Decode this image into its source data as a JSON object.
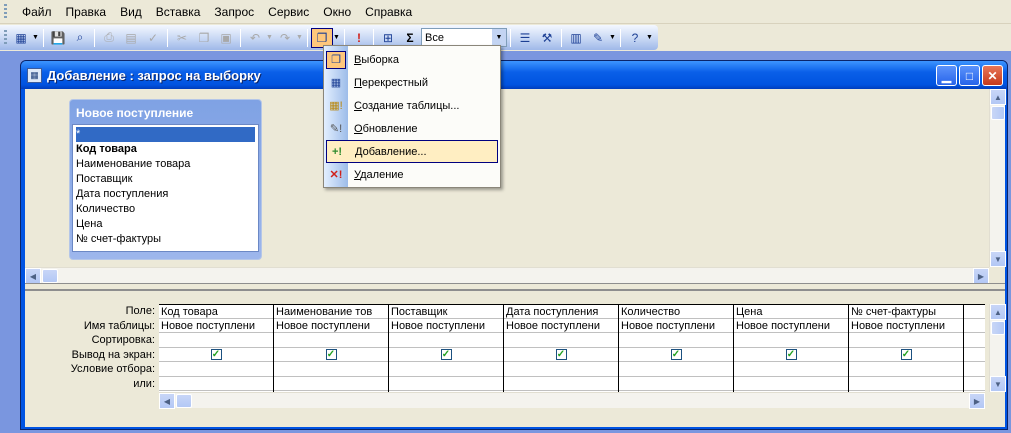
{
  "menubar": {
    "items": [
      "Файл",
      "Правка",
      "Вид",
      "Вставка",
      "Запрос",
      "Сервис",
      "Окно",
      "Справка"
    ]
  },
  "toolbar": {
    "combo_value": "Все",
    "icons": [
      "view-icon",
      "save-icon",
      "search-icon",
      "print-icon",
      "preview-icon",
      "spell-icon",
      "cut-icon",
      "copy-icon",
      "paste-icon",
      "undo-icon",
      "redo-icon",
      "query-type-icon",
      "run-icon",
      "show-table-icon",
      "totals-icon",
      "properties-icon",
      "build-icon",
      "database-window-icon",
      "new-object-icon",
      "help-icon"
    ]
  },
  "window": {
    "title": "Добавление : запрос на выборку"
  },
  "field_list": {
    "title": "Новое поступление",
    "fields": [
      "*",
      "Код товара",
      "Наименование товара",
      "Поставщик",
      "Дата поступления",
      "Количество",
      "Цена",
      "№ счет-фактуры"
    ]
  },
  "query_grid": {
    "row_labels": [
      "Поле:",
      "Имя таблицы:",
      "Сортировка:",
      "Вывод на экран:",
      "Условие отбора:",
      "или:"
    ],
    "columns": [
      {
        "field": "Код товара",
        "table": "Новое поступлени",
        "show": true
      },
      {
        "field": "Наименование тов",
        "table": "Новое поступлени",
        "show": true
      },
      {
        "field": "Поставщик",
        "table": "Новое поступлени",
        "show": true
      },
      {
        "field": "Дата поступления",
        "table": "Новое поступлени",
        "show": true
      },
      {
        "field": "Количество",
        "table": "Новое поступлени",
        "show": true
      },
      {
        "field": "Цена",
        "table": "Новое поступлени",
        "show": true
      },
      {
        "field": "№ счет-фактуры",
        "table": "Новое поступлени",
        "show": true
      },
      {
        "field": "",
        "table": "",
        "show": false
      }
    ]
  },
  "query_type_menu": {
    "items": [
      {
        "label": "Выборка",
        "icon": "select-query-icon",
        "state": "checked"
      },
      {
        "label": "Перекрестный",
        "icon": "crosstab-query-icon",
        "state": ""
      },
      {
        "label": "Создание таблицы...",
        "icon": "make-table-query-icon",
        "state": ""
      },
      {
        "label": "Обновление",
        "icon": "update-query-icon",
        "state": ""
      },
      {
        "label": "Добавление...",
        "icon": "append-query-icon",
        "state": "highlighted"
      },
      {
        "label": "Удаление",
        "icon": "delete-query-icon",
        "state": ""
      }
    ]
  },
  "colors": {
    "title_bar": "#0054e3",
    "highlight": "#ffeec2",
    "checked": "#fec77c"
  }
}
